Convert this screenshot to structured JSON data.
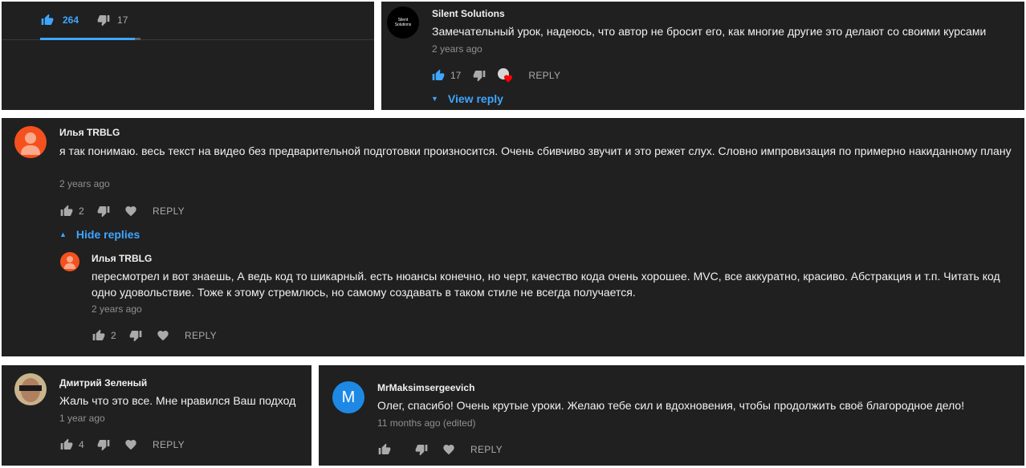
{
  "icons": {
    "like": "thumb-up-icon",
    "dislike": "thumb-down-icon",
    "heart": "heart-icon",
    "expand": "triangle-down-icon",
    "collapse": "triangle-up-icon"
  },
  "colors": {
    "panel_bg": "#202020",
    "accent_blue": "#3ea6ff",
    "meta_gray": "#909090",
    "avatar_orange": "#f4511e",
    "avatar_blue": "#1e88e5"
  },
  "video_bar": {
    "likes": "264",
    "dislikes": "17",
    "like_ratio": 0.94
  },
  "comments": [
    {
      "author": "Silent Solutions",
      "avatar_text": "Silent Solutions",
      "text": "Замечательный урок, надеюсь, что автор не бросит его, как многие другие это делают со своими курсами",
      "time": "2 years ago",
      "likes": "17",
      "reply_label": "REPLY",
      "toggle_label": "View reply"
    },
    {
      "author": "Илья TRBLG",
      "text": "я так понимаю. весь текст на видео без предварительной подготовки произносится. Очень сбивчиво звучит и это режет слух. Словно импровизация по примерно накиданному плану",
      "time": "2 years ago",
      "likes": "2",
      "reply_label": "REPLY",
      "toggle_label": "Hide replies",
      "reply": {
        "author": "Илья TRBLG",
        "text": "пересмотрел и вот знаешь, А ведь код то шикарный. есть нюансы конечно, но черт, качество кода очень хорошее. MVC,  все аккуратно, красиво. Абстракция и т.п. Читать код одно удовольствие. Тоже к этому стремлюсь, но самому создавать в таком стиле не всегда получается.",
        "time": "2 years ago",
        "likes": "2",
        "reply_label": "REPLY"
      }
    },
    {
      "author": "Дмитрий Зеленый",
      "text": "Жаль что это все. Мне нравился Ваш подход",
      "time": "1 year ago",
      "likes": "4",
      "reply_label": "REPLY"
    },
    {
      "author": "MrMaksimsergeevich",
      "avatar_letter": "M",
      "text": "Олег, спасибо! Очень крутые уроки. Желаю тебе сил и вдохновения, чтобы продолжить своё благородное дело!",
      "time": "11 months ago (edited)",
      "likes": "",
      "reply_label": "REPLY"
    }
  ]
}
